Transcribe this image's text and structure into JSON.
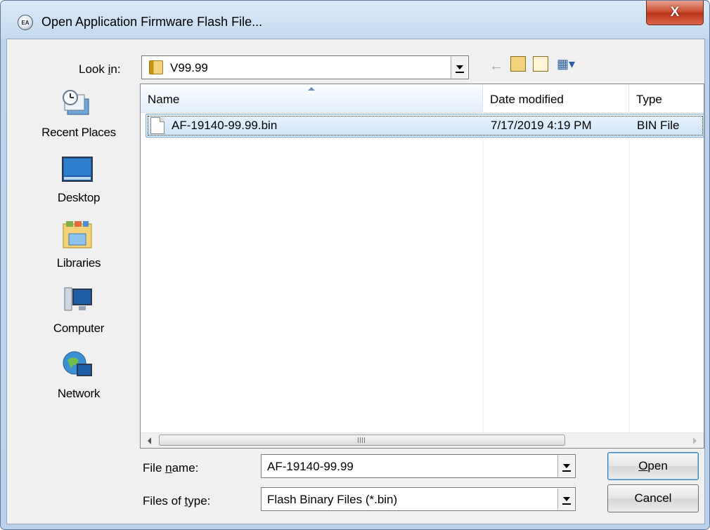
{
  "window": {
    "title": "Open Application Firmware Flash File...",
    "app_icon_text": "EA",
    "close_glyph": "X"
  },
  "lookin": {
    "label": "Look in:",
    "value": "V99.99"
  },
  "toolbar": {
    "back_glyph": "←",
    "up_glyph": "⮤",
    "new_folder_glyph": "✱",
    "view_glyph": "▦▾"
  },
  "places": [
    {
      "label": "Recent Places",
      "icon": "recent-places-icon"
    },
    {
      "label": "Desktop",
      "icon": "desktop-icon"
    },
    {
      "label": "Libraries",
      "icon": "libraries-icon"
    },
    {
      "label": "Computer",
      "icon": "computer-icon"
    },
    {
      "label": "Network",
      "icon": "network-icon"
    }
  ],
  "columns": {
    "name": "Name",
    "date": "Date modified",
    "type": "Type"
  },
  "files": [
    {
      "name": "AF-19140-99.99.bin",
      "date": "7/17/2019 4:19 PM",
      "type": "BIN File",
      "selected": true
    }
  ],
  "scrollbar": {
    "grip": "III"
  },
  "filename": {
    "label_pre": "File ",
    "label_u": "n",
    "label_post": "ame:",
    "value": "AF-19140-99.99"
  },
  "filetype": {
    "label_pre": "Files of ",
    "label_u": "t",
    "label_post": "ype:",
    "value": "Flash Binary Files (*.bin)"
  },
  "buttons": {
    "open_u": "O",
    "open_rest": "pen",
    "cancel": "Cancel"
  },
  "colors": {
    "title_bg": "#c4d9f0",
    "close_red": "#c7462b",
    "selection": "#cce4f9"
  }
}
